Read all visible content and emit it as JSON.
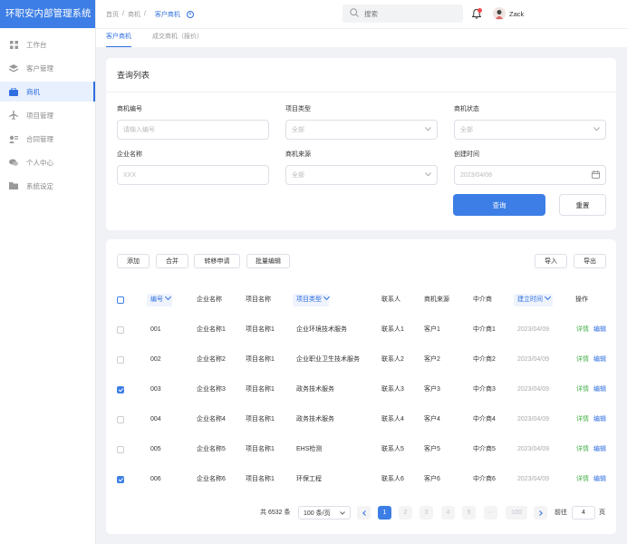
{
  "app": {
    "title": "环职安内部管理系统"
  },
  "sidebar": {
    "items": [
      {
        "label": "工作台",
        "icon": "grid-icon"
      },
      {
        "label": "客户管理",
        "icon": "layers-icon"
      },
      {
        "label": "商机",
        "icon": "briefcase-icon",
        "active": true
      },
      {
        "label": "项目管理",
        "icon": "airplane-icon"
      },
      {
        "label": "合同管理",
        "icon": "contract-icon"
      },
      {
        "label": "个人中心",
        "icon": "chat-icon"
      },
      {
        "label": "系统设定",
        "icon": "folder-icon"
      }
    ]
  },
  "header": {
    "breadcrumb": [
      "首页",
      "商机"
    ],
    "current_tab": "客户商机",
    "search_placeholder": "搜索",
    "username": "Zack"
  },
  "tabs": [
    "客户商机",
    "成交商机（报价）"
  ],
  "query": {
    "title": "查询列表",
    "fields": {
      "code": {
        "label": "商机编号",
        "placeholder": "请输入编号"
      },
      "type": {
        "label": "项目类型",
        "value": "全部"
      },
      "status": {
        "label": "商机状态",
        "value": "全部"
      },
      "company": {
        "label": "企业名称",
        "placeholder": "XXX"
      },
      "source": {
        "label": "商机来源",
        "value": "全部"
      },
      "created": {
        "label": "创建时间",
        "value": "2023/04/08"
      }
    },
    "search_btn": "查询",
    "reset_btn": "重置"
  },
  "toolbar": {
    "add": "添加",
    "merge": "合并",
    "transfer": "转移申请",
    "batch_edit": "批量编辑",
    "import": "导入",
    "export": "导出"
  },
  "table": {
    "columns": [
      "编号",
      "企业名称",
      "项目名称",
      "项目类型",
      "联系人",
      "商机来源",
      "中介商",
      "建立时间",
      "操作"
    ],
    "view_label": "详情",
    "edit_label": "编辑",
    "rows": [
      {
        "id": "001",
        "company": "企业名称1",
        "project": "项目名称1",
        "type": "企业环境技术服务",
        "contact": "联系人1",
        "source": "客户1",
        "agent": "中介商1",
        "date": "2023/04/09",
        "checked": false
      },
      {
        "id": "002",
        "company": "企业名称2",
        "project": "项目名称1",
        "type": "企业职业卫生技术服务",
        "contact": "联系人2",
        "source": "客户2",
        "agent": "中介商2",
        "date": "2023/04/09",
        "checked": false
      },
      {
        "id": "003",
        "company": "企业名称3",
        "project": "项目名称1",
        "type": "政务技术服务",
        "contact": "联系人3",
        "source": "客户3",
        "agent": "中介商3",
        "date": "2023/04/09",
        "checked": true
      },
      {
        "id": "004",
        "company": "企业名称4",
        "project": "项目名称1",
        "type": "政务技术服务",
        "contact": "联系人4",
        "source": "客户4",
        "agent": "中介商4",
        "date": "2023/04/09",
        "checked": false
      },
      {
        "id": "005",
        "company": "企业名称5",
        "project": "项目名称1",
        "type": "EHS检测",
        "contact": "联系人5",
        "source": "客户5",
        "agent": "中介商5",
        "date": "2023/04/09",
        "checked": false
      },
      {
        "id": "006",
        "company": "企业名称6",
        "project": "项目名称1",
        "type": "环保工程",
        "contact": "联系人6",
        "source": "客户6",
        "agent": "中介商6",
        "date": "2023/04/09",
        "checked": true
      }
    ]
  },
  "pagination": {
    "total": "共 6532 条",
    "page_size": "100 条/页",
    "pages": [
      "1",
      "2",
      "3",
      "4",
      "5",
      "···",
      "100"
    ],
    "goto_label": "前往",
    "goto_value": "4",
    "page_unit": "页"
  },
  "colors": {
    "primary": "#3c7ee5",
    "view": "#48b14a",
    "badge": "#f5484c"
  }
}
